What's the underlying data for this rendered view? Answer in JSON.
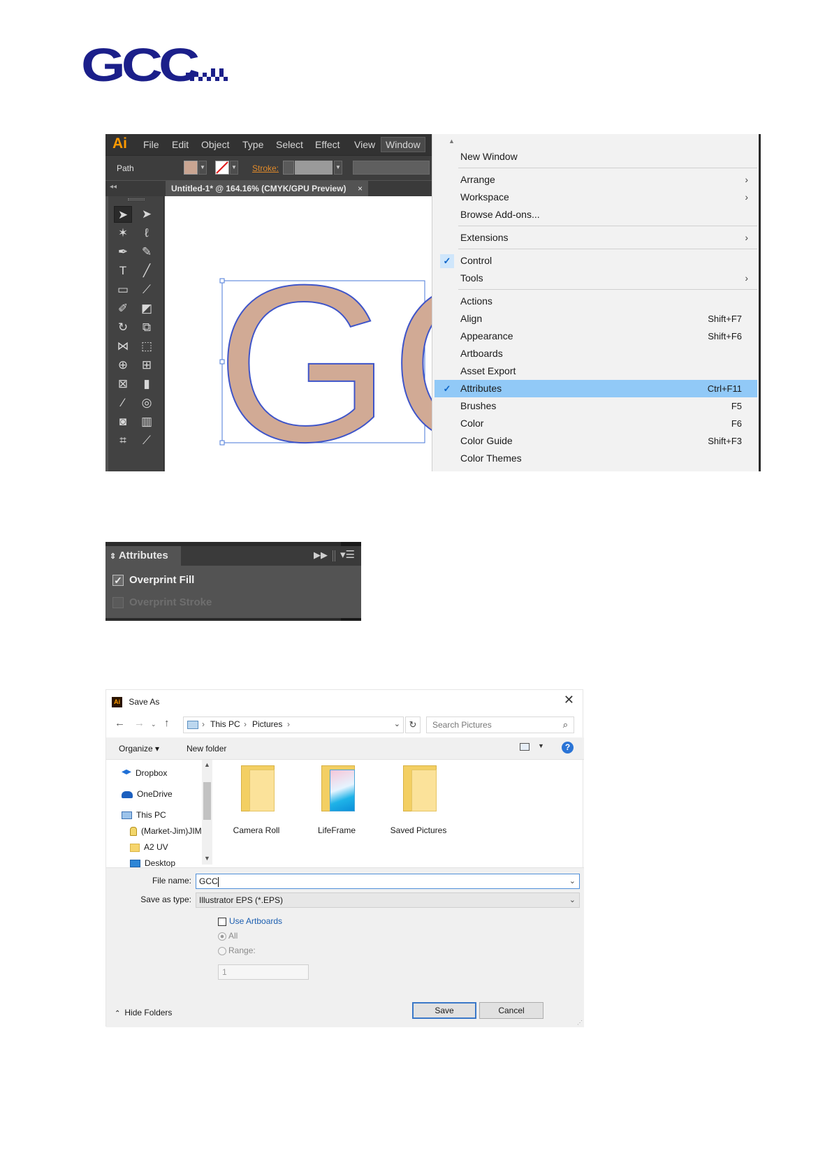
{
  "logo": {
    "text": "GCC",
    "color": "#1b1f8a"
  },
  "illustrator": {
    "app_icon": "Ai",
    "menubar": [
      "File",
      "Edit",
      "Object",
      "Type",
      "Select",
      "Effect",
      "View",
      "Window"
    ],
    "control": {
      "selection": "Path",
      "stroke_label": "Stroke:"
    },
    "doc_tab": {
      "title": "Untitled-1* @ 164.16% (CMYK/GPU Preview)",
      "close": "×"
    },
    "artwork_text": "GC",
    "window_menu": {
      "items": [
        {
          "label": "New Window"
        },
        {
          "label": "Arrange",
          "submenu": true
        },
        {
          "label": "Workspace",
          "submenu": true
        },
        {
          "label": "Browse Add-ons..."
        },
        {
          "label": "Extensions",
          "submenu": true
        },
        {
          "label": "Control",
          "checked": true
        },
        {
          "label": "Tools",
          "submenu": true
        },
        {
          "label": "Actions"
        },
        {
          "label": "Align",
          "shortcut": "Shift+F7"
        },
        {
          "label": "Appearance",
          "shortcut": "Shift+F6"
        },
        {
          "label": "Artboards"
        },
        {
          "label": "Asset Export"
        },
        {
          "label": "Attributes",
          "shortcut": "Ctrl+F11",
          "checked": true,
          "highlighted": true
        },
        {
          "label": "Brushes",
          "shortcut": "F5"
        },
        {
          "label": "Color",
          "shortcut": "F6"
        },
        {
          "label": "Color Guide",
          "shortcut": "Shift+F3"
        },
        {
          "label": "Color Themes"
        }
      ],
      "highlight_color": "#91c9f7"
    }
  },
  "attributes_panel": {
    "tab": "Attributes",
    "overprint_fill": {
      "label": "Overprint Fill",
      "checked": true
    },
    "overprint_stroke": {
      "label": "Overprint Stroke",
      "checked": false,
      "disabled": true
    }
  },
  "save_dialog": {
    "title": "Save As",
    "breadcrumb": [
      "This PC",
      "Pictures"
    ],
    "search_placeholder": "Search Pictures",
    "toolbar": {
      "organize": "Organize ▾",
      "new_folder": "New folder"
    },
    "nav": [
      "Dropbox",
      "OneDrive",
      "This PC",
      "(Market-Jim)JIM",
      "A2 UV",
      "Desktop"
    ],
    "folders": [
      "Camera Roll",
      "LifeFrame",
      "Saved Pictures"
    ],
    "file_name_label": "File name:",
    "file_name": "GCC",
    "save_type_label": "Save as type:",
    "save_type": "Illustrator EPS (*.EPS)",
    "use_artboards": "Use Artboards",
    "all_label": "All",
    "range_label": "Range:",
    "range_value": "1",
    "hide_folders": "Hide Folders",
    "save_button": "Save",
    "cancel_button": "Cancel"
  }
}
